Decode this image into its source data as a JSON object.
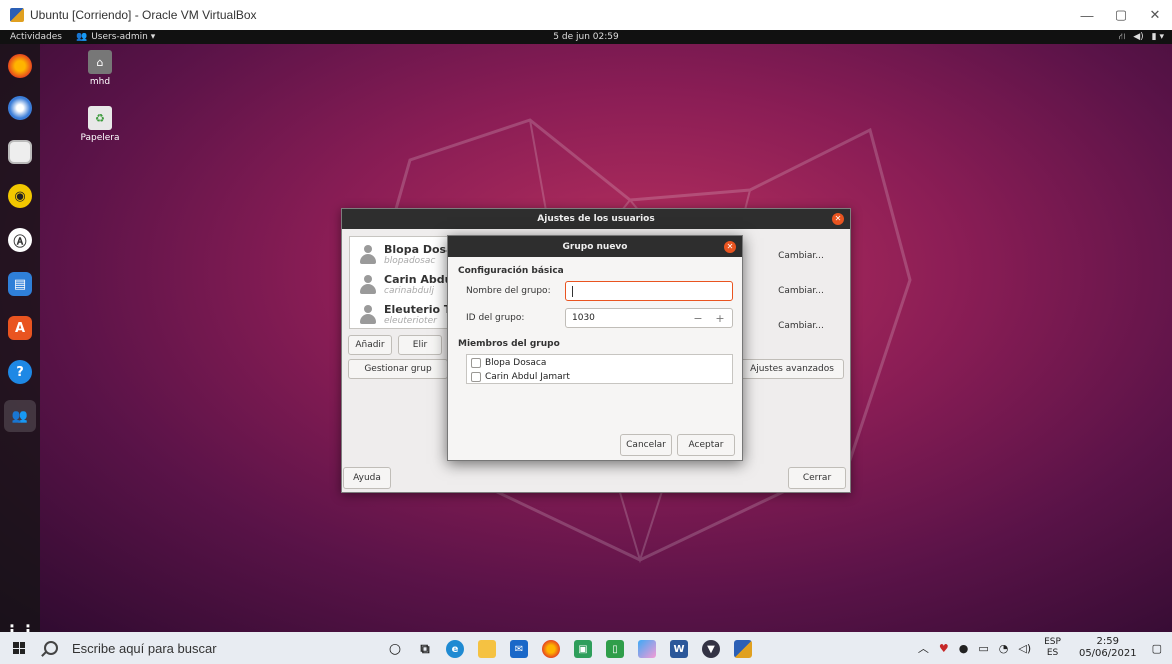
{
  "host_window": {
    "title": "Ubuntu [Corriendo] - Oracle VM VirtualBox",
    "controls": [
      "—",
      "▢",
      "✕"
    ]
  },
  "topbar": {
    "activities": "Actividades",
    "app_name": "Users-admin ▾",
    "clock": "5 de jun  02:59",
    "tray": [
      "⛙",
      "◀)",
      "▮ ▾"
    ]
  },
  "dock": {
    "items": [
      "firefox-icon",
      "thunderbird-icon",
      "files-icon",
      "rhythmbox-icon",
      "software-icon",
      "writer-icon",
      "app-center-icon",
      "help-icon",
      "users-icon",
      "show-apps-icon"
    ]
  },
  "desktop": {
    "icons": [
      {
        "label": "mhd",
        "glyph": "⌂"
      },
      {
        "label": "Papelera",
        "glyph": "♻"
      }
    ]
  },
  "users_dialog": {
    "title": "Ajustes de los usuarios",
    "users": [
      {
        "name": "Blopa Dosa",
        "login": "blopadosac"
      },
      {
        "name": "Carin Abdu",
        "login": "carinabdulj"
      },
      {
        "name": "Eleuterio T",
        "login": "eleuterioter"
      }
    ],
    "change_label": "Cambiar...",
    "add_label": "Añadir",
    "delete_label": "Elir",
    "manage_groups_label": "Gestionar grup",
    "advanced_label": "Ajustes avanzados",
    "help_label": "Ayuda",
    "close_label": "Cerrar"
  },
  "group_dialog": {
    "title": "Grupo nuevo",
    "basic_config_label": "Configuración básica",
    "group_name_label": "Nombre del grupo:",
    "group_name_value": "",
    "group_id_label": "ID del grupo:",
    "group_id_value": "1030",
    "minus": "−",
    "plus": "+",
    "members_label": "Miembros del grupo",
    "members": [
      "Blopa Dosaca",
      "Carin Abdul Jamart"
    ],
    "cancel_label": "Cancelar",
    "accept_label": "Aceptar"
  },
  "taskbar": {
    "search_placeholder": "Escribe aquí para buscar",
    "lang_top": "ESP",
    "lang_bottom": "ES",
    "time": "2:59",
    "date": "05/06/2021"
  }
}
